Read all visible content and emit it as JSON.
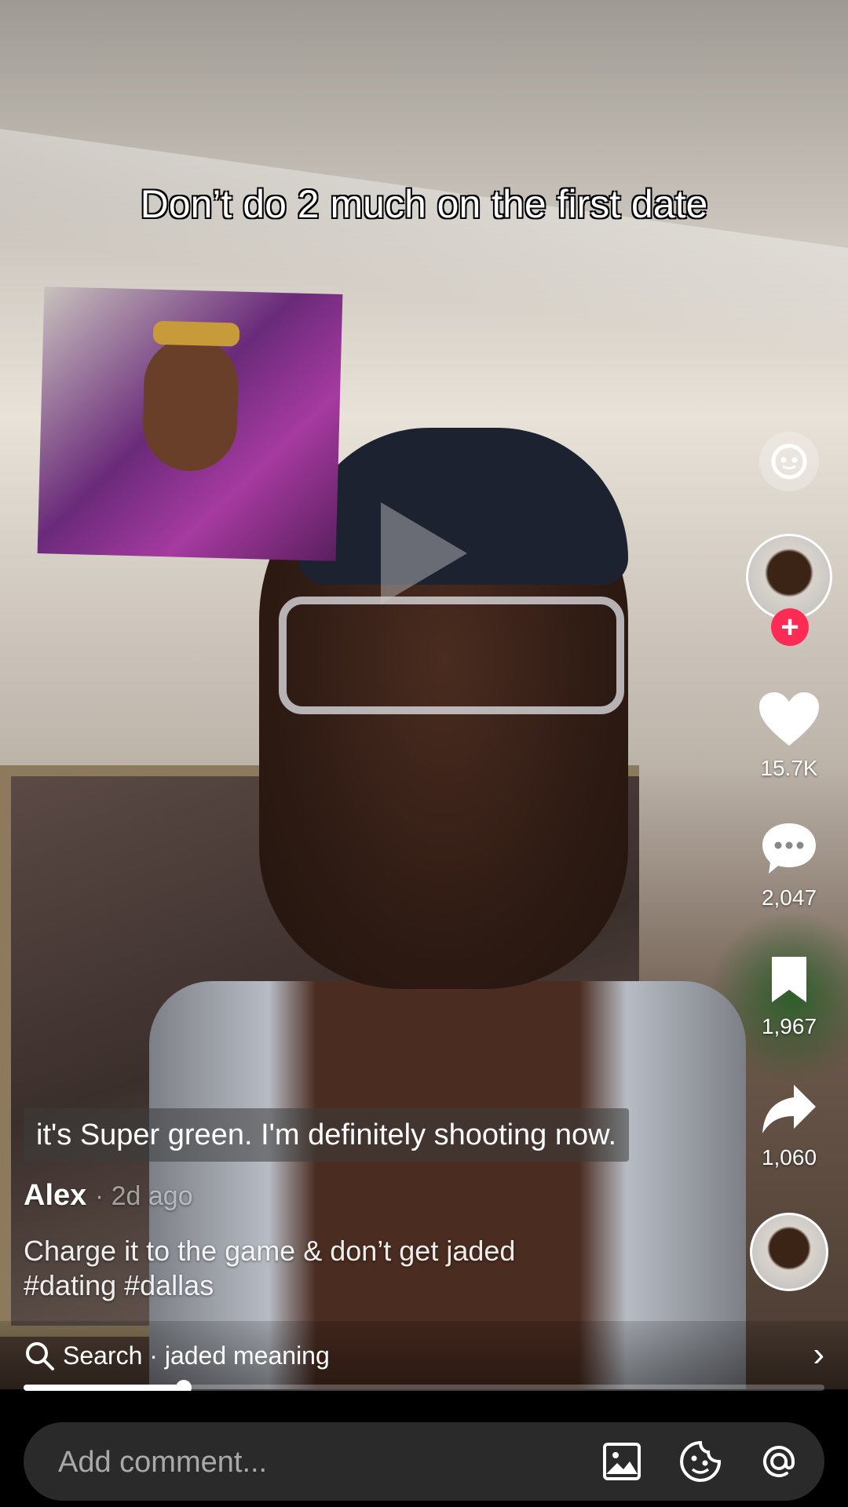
{
  "overlay_text": "Don’t do 2 much on the first date",
  "right_rail": {
    "likes": "15.7K",
    "comments": "2,047",
    "saves": "1,967",
    "shares": "1,060"
  },
  "auto_caption": "it's Super green. I'm definitely shooting now.",
  "author": {
    "name": "Alex",
    "posted": "· 2d ago"
  },
  "description": "Charge it to the game & don’t get jaded #dating #dallas",
  "search": {
    "label": "Search",
    "query": "· jaded meaning"
  },
  "progress": 0.2,
  "comment_input": {
    "placeholder": "Add comment..."
  },
  "icons": {
    "brand_accent": "#fe2c55"
  }
}
